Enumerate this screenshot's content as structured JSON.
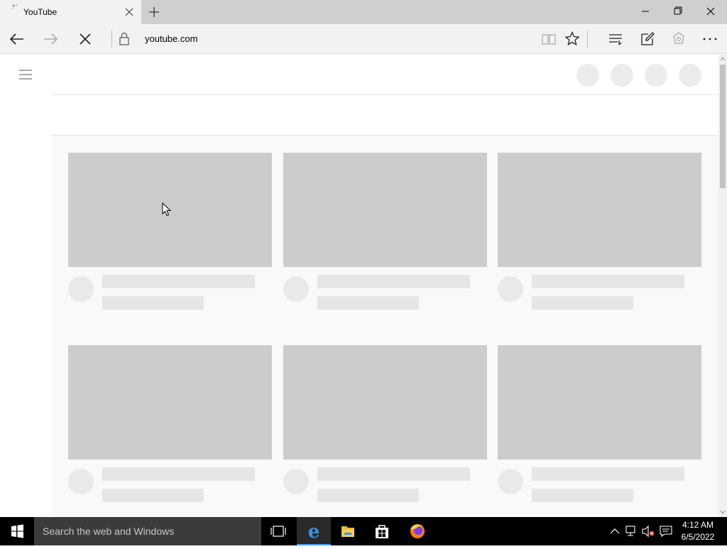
{
  "browser": {
    "tab": {
      "title": "YouTube"
    },
    "address_bar": {
      "url": "youtube.com"
    }
  },
  "taskbar": {
    "search_placeholder": "Search the web and Windows",
    "clock": {
      "time": "4:12 AM",
      "date": "6/5/2022"
    },
    "pinned_apps": [
      "task-view",
      "microsoft-edge",
      "file-explorer",
      "store",
      "firefox"
    ]
  },
  "page": {
    "state": "loading-skeleton",
    "video_cards": [
      {},
      {},
      {},
      {},
      {},
      {}
    ]
  },
  "colors": {
    "skeleton_thumb": "#cccccc",
    "skeleton_line": "#e6e6e6",
    "feed_background": "#f9f9f9",
    "taskbar": "#000000",
    "edge_accent": "#4aa3ff"
  }
}
